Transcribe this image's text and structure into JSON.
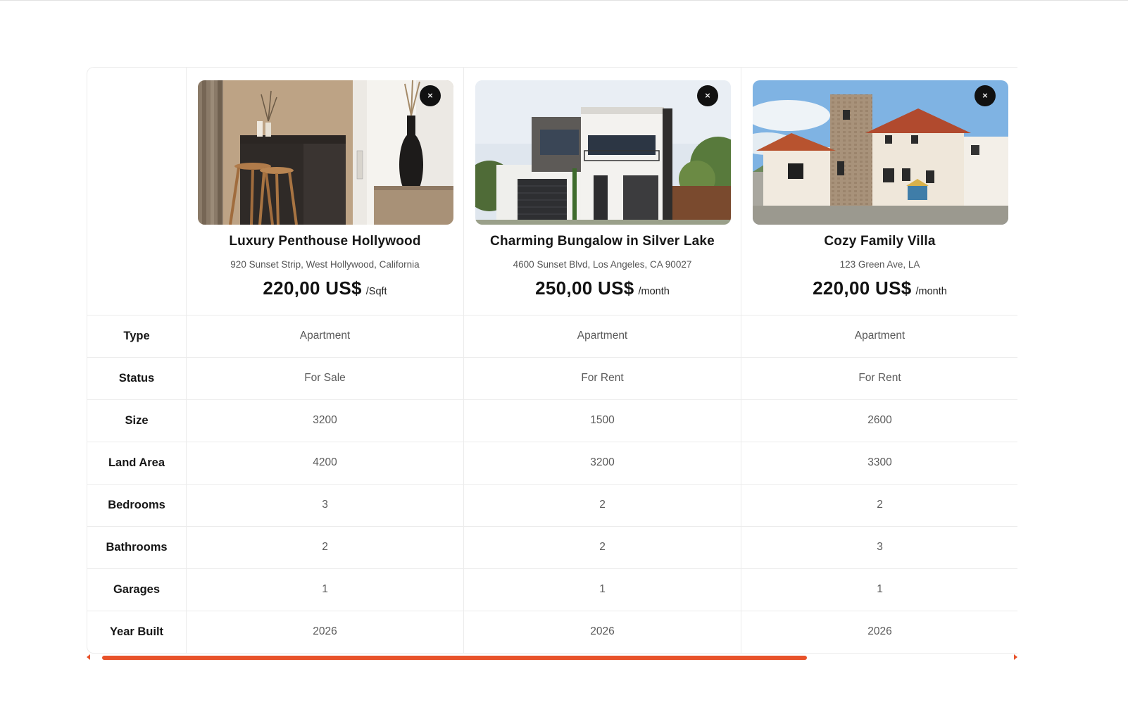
{
  "colors": {
    "accent": "#e8522a",
    "remove_button": "#111111",
    "border": "#ececec"
  },
  "properties": [
    {
      "image": "interior-kitchen-photo",
      "title": "Luxury Penthouse Hollywood",
      "address": "920 Sunset Strip, West Hollywood, California",
      "price": "220,00 US$",
      "price_unit": "/Sqft",
      "remove_icon": "×"
    },
    {
      "image": "modern-house-photo",
      "title": "Charming Bungalow in Silver Lake",
      "address": "4600 Sunset Blvd, Los Angeles, CA 90027",
      "price": "250,00 US$",
      "price_unit": "/month",
      "remove_icon": "×"
    },
    {
      "image": "villa-house-photo",
      "title": "Cozy Family Villa",
      "address": "123 Green Ave, LA",
      "price": "220,00 US$",
      "price_unit": "/month",
      "remove_icon": "×"
    }
  ],
  "rows": [
    {
      "label": "Type",
      "values": [
        "Apartment",
        "Apartment",
        "Apartment"
      ]
    },
    {
      "label": "Status",
      "values": [
        "For Sale",
        "For Rent",
        "For Rent"
      ]
    },
    {
      "label": "Size",
      "values": [
        "3200",
        "1500",
        "2600"
      ]
    },
    {
      "label": "Land Area",
      "values": [
        "4200",
        "3200",
        "3300"
      ]
    },
    {
      "label": "Bedrooms",
      "values": [
        "3",
        "2",
        "2"
      ]
    },
    {
      "label": "Bathrooms",
      "values": [
        "2",
        "2",
        "3"
      ]
    },
    {
      "label": "Garages",
      "values": [
        "1",
        "1",
        "1"
      ]
    },
    {
      "label": "Year Built",
      "values": [
        "2026",
        "2026",
        "2026"
      ]
    }
  ],
  "scrollbar": {
    "scroll_fraction_visible": 0.77
  }
}
